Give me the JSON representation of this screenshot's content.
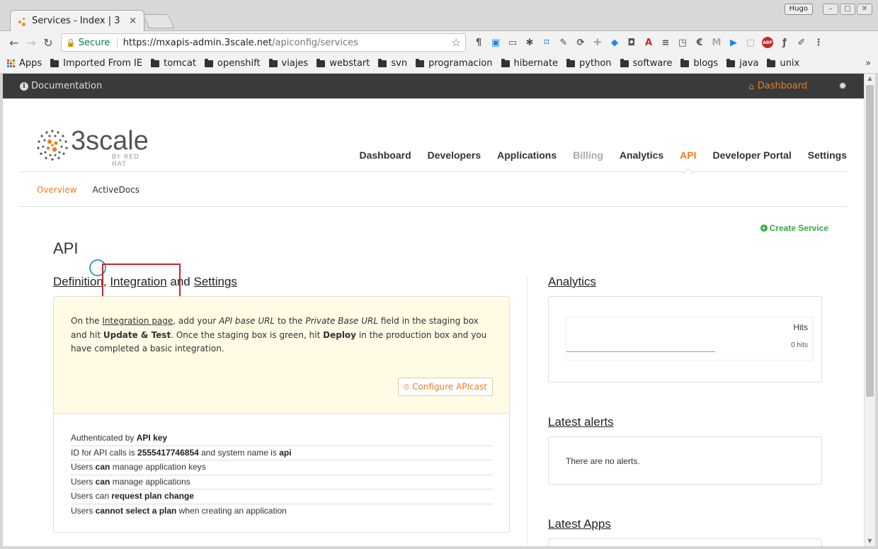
{
  "browser": {
    "tab_title": "Services - Index | 3",
    "tab_close": "×",
    "profile": "Hugo",
    "url_secure": "Secure",
    "url_host": "https://mxapis-admin.3scale.net",
    "url_path": "/apiconfig/services",
    "bookmarks": [
      {
        "label": "Apps",
        "type": "apps"
      },
      {
        "label": "Imported From IE",
        "type": "folder"
      },
      {
        "label": "tomcat",
        "type": "folder"
      },
      {
        "label": "openshift",
        "type": "folder"
      },
      {
        "label": "viajes",
        "type": "folder"
      },
      {
        "label": "webstart",
        "type": "folder"
      },
      {
        "label": "svn",
        "type": "folder"
      },
      {
        "label": "programacion",
        "type": "folder"
      },
      {
        "label": "hibernate",
        "type": "folder"
      },
      {
        "label": "python",
        "type": "folder"
      },
      {
        "label": "software",
        "type": "folder"
      },
      {
        "label": "blogs",
        "type": "folder"
      },
      {
        "label": "java",
        "type": "folder"
      },
      {
        "label": "unix",
        "type": "folder"
      }
    ],
    "bookmarks_more": "»"
  },
  "adminbar": {
    "documentation": "Documentation",
    "dashboard": "Dashboard"
  },
  "logo": {
    "word": "3scale",
    "by": "BY RED HAT"
  },
  "nav": {
    "dashboard": "Dashboard",
    "developers": "Developers",
    "applications": "Applications",
    "billing": "Billing",
    "analytics": "Analytics",
    "api": "API",
    "developer_portal": "Developer Portal",
    "settings": "Settings"
  },
  "subnav": {
    "overview": "Overview",
    "activedocs": "ActiveDocs"
  },
  "page": {
    "create_service": "Create Service",
    "title": "API"
  },
  "definition": {
    "link_definition": "Definition",
    "comma": ", ",
    "link_integration": "Integration",
    "and": " and ",
    "link_settings": "Settings",
    "text_on_the": "On the ",
    "integration_page": "Integration page",
    "text_add_your": ", add your ",
    "api_base_url": "API base URL",
    "text_to_the": " to the ",
    "private_base_url": "Private Base URL",
    "text_field": " field in the staging box and hit ",
    "update_test": "Update & Test",
    "text_once": ". Once the staging box is green, hit ",
    "deploy": "Deploy",
    "text_end": " in the production box and you have completed a basic integration.",
    "configure_button": "Configure APIcast",
    "facts": {
      "auth_prefix": "Authenticated by ",
      "auth_value": "API key",
      "id_prefix": "ID for API calls is ",
      "id_value": "2555417746854",
      "id_mid": " and system name is ",
      "system_name": "api",
      "keys_prefix": "Users ",
      "keys_can": "can",
      "keys_suffix": " manage application keys",
      "apps_prefix": "Users ",
      "apps_can": "can",
      "apps_suffix": " manage applications",
      "plan_prefix": "Users can ",
      "plan_value": "request plan change",
      "select_prefix": "Users ",
      "select_value": "cannot select a plan",
      "select_suffix": " when creating an application"
    }
  },
  "analytics": {
    "heading": "Analytics",
    "series_label": "Hits",
    "total": "0 hits"
  },
  "alerts": {
    "heading": "Latest alerts",
    "empty": "There are no alerts."
  },
  "latest_apps": {
    "heading": "Latest Apps"
  },
  "colors": {
    "accent": "#ee7d1e",
    "success": "#3aa64a",
    "adminbar": "#3a3a3a",
    "highlight": "#c62828"
  }
}
